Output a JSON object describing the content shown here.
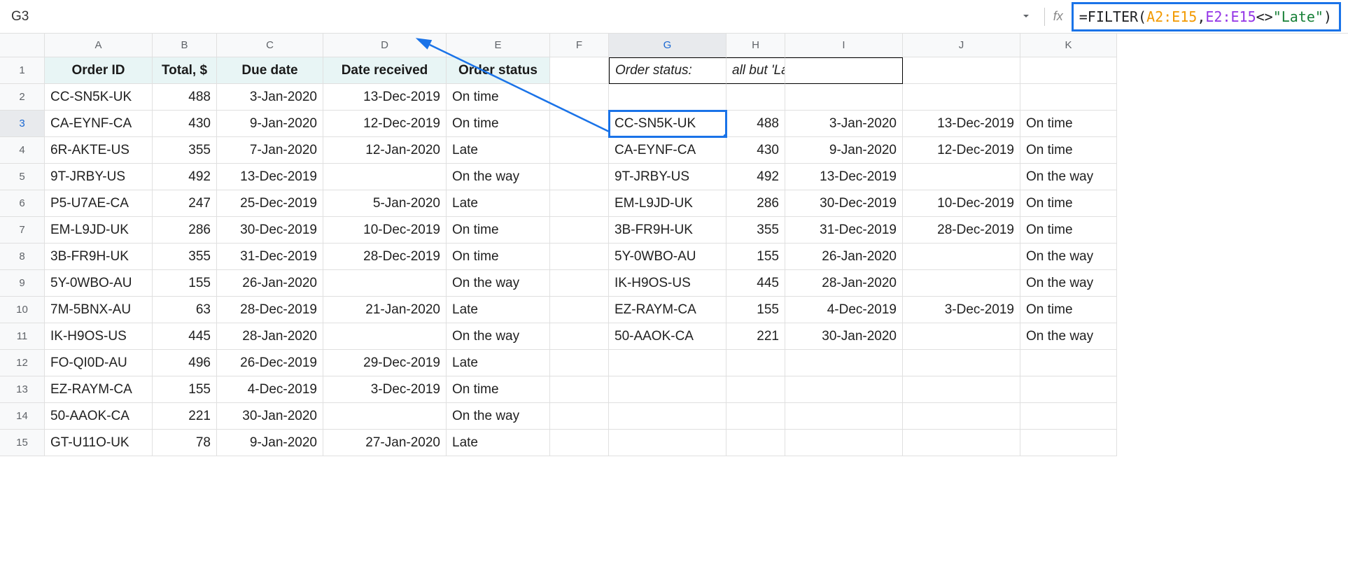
{
  "nameBox": "G3",
  "formula": {
    "prefix": "=FILTER(",
    "range1": "A2:E15",
    "comma": ",",
    "range2": "E2:E15",
    "op": "<>",
    "str": "\"Late\"",
    "close": ")"
  },
  "cols": [
    "A",
    "B",
    "C",
    "D",
    "E",
    "F",
    "G",
    "H",
    "I",
    "J",
    "K"
  ],
  "rows": [
    "1",
    "2",
    "3",
    "4",
    "5",
    "6",
    "7",
    "8",
    "9",
    "10",
    "11",
    "12",
    "13",
    "14",
    "15"
  ],
  "headers": {
    "A": "Order ID",
    "B": "Total, $",
    "C": "Due date",
    "D": "Date received",
    "E": "Order status"
  },
  "g1": "Order status:",
  "h1": "all but 'Late'",
  "data": [
    {
      "A": "CC-SN5K-UK",
      "B": "488",
      "C": "3-Jan-2020",
      "D": "13-Dec-2019",
      "E": "On time"
    },
    {
      "A": "CA-EYNF-CA",
      "B": "430",
      "C": "9-Jan-2020",
      "D": "12-Dec-2019",
      "E": "On time"
    },
    {
      "A": "6R-AKTE-US",
      "B": "355",
      "C": "7-Jan-2020",
      "D": "12-Jan-2020",
      "E": "Late"
    },
    {
      "A": "9T-JRBY-US",
      "B": "492",
      "C": "13-Dec-2019",
      "D": "",
      "E": "On the way"
    },
    {
      "A": "P5-U7AE-CA",
      "B": "247",
      "C": "25-Dec-2019",
      "D": "5-Jan-2020",
      "E": "Late"
    },
    {
      "A": "EM-L9JD-UK",
      "B": "286",
      "C": "30-Dec-2019",
      "D": "10-Dec-2019",
      "E": "On time"
    },
    {
      "A": "3B-FR9H-UK",
      "B": "355",
      "C": "31-Dec-2019",
      "D": "28-Dec-2019",
      "E": "On time"
    },
    {
      "A": "5Y-0WBO-AU",
      "B": "155",
      "C": "26-Jan-2020",
      "D": "",
      "E": "On the way"
    },
    {
      "A": "7M-5BNX-AU",
      "B": "63",
      "C": "28-Dec-2019",
      "D": "21-Jan-2020",
      "E": "Late"
    },
    {
      "A": "IK-H9OS-US",
      "B": "445",
      "C": "28-Jan-2020",
      "D": "",
      "E": "On the way"
    },
    {
      "A": "FO-QI0D-AU",
      "B": "496",
      "C": "26-Dec-2019",
      "D": "29-Dec-2019",
      "E": "Late"
    },
    {
      "A": "EZ-RAYM-CA",
      "B": "155",
      "C": "4-Dec-2019",
      "D": "3-Dec-2019",
      "E": "On time"
    },
    {
      "A": "50-AAOK-CA",
      "B": "221",
      "C": "30-Jan-2020",
      "D": "",
      "E": "On the way"
    },
    {
      "A": "GT-U11O-UK",
      "B": "78",
      "C": "9-Jan-2020",
      "D": "27-Jan-2020",
      "E": "Late"
    }
  ],
  "filtered": [
    {
      "G": "CC-SN5K-UK",
      "H": "488",
      "I": "3-Jan-2020",
      "J": "13-Dec-2019",
      "K": "On time"
    },
    {
      "G": "CA-EYNF-CA",
      "H": "430",
      "I": "9-Jan-2020",
      "J": "12-Dec-2019",
      "K": "On time"
    },
    {
      "G": "9T-JRBY-US",
      "H": "492",
      "I": "13-Dec-2019",
      "J": "",
      "K": "On the way"
    },
    {
      "G": "EM-L9JD-UK",
      "H": "286",
      "I": "30-Dec-2019",
      "J": "10-Dec-2019",
      "K": "On time"
    },
    {
      "G": "3B-FR9H-UK",
      "H": "355",
      "I": "31-Dec-2019",
      "J": "28-Dec-2019",
      "K": "On time"
    },
    {
      "G": "5Y-0WBO-AU",
      "H": "155",
      "I": "26-Jan-2020",
      "J": "",
      "K": "On the way"
    },
    {
      "G": "IK-H9OS-US",
      "H": "445",
      "I": "28-Jan-2020",
      "J": "",
      "K": "On the way"
    },
    {
      "G": "EZ-RAYM-CA",
      "H": "155",
      "I": "4-Dec-2019",
      "J": "3-Dec-2019",
      "K": "On time"
    },
    {
      "G": "50-AAOK-CA",
      "H": "221",
      "I": "30-Jan-2020",
      "J": "",
      "K": "On the way"
    }
  ]
}
